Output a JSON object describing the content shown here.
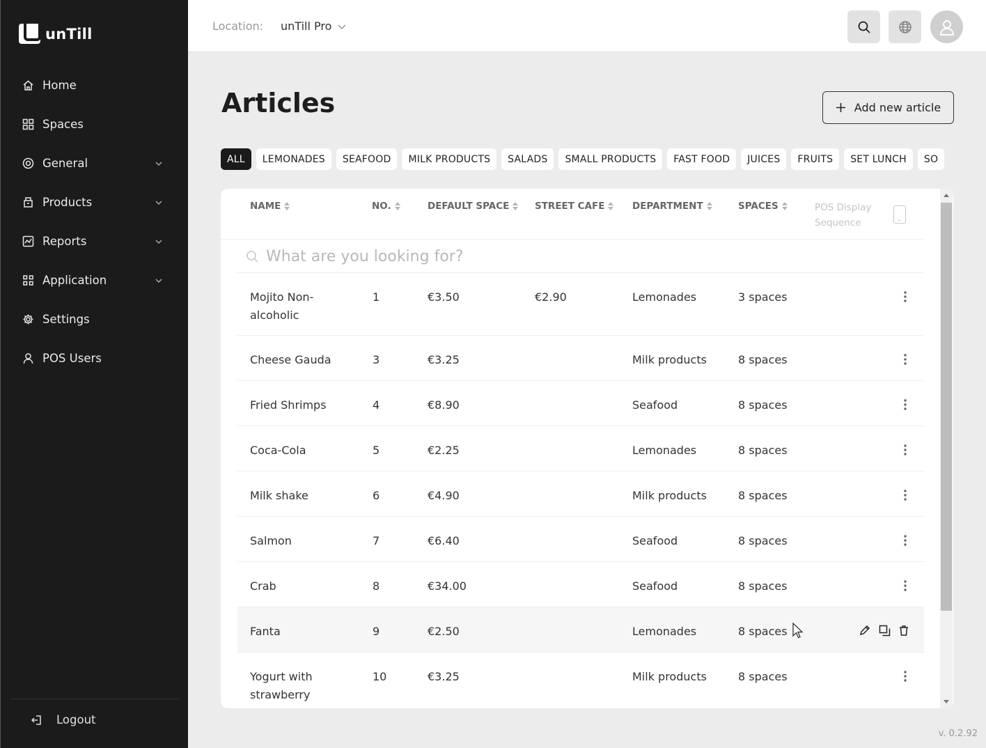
{
  "brand": {
    "name": "unTill"
  },
  "sidebar": {
    "items": [
      {
        "label": "Home",
        "icon": "home-icon",
        "expandable": false
      },
      {
        "label": "Spaces",
        "icon": "grid-icon",
        "expandable": false
      },
      {
        "label": "General",
        "icon": "target-icon",
        "expandable": true
      },
      {
        "label": "Products",
        "icon": "box-icon",
        "expandable": true
      },
      {
        "label": "Reports",
        "icon": "chart-icon",
        "expandable": true
      },
      {
        "label": "Application",
        "icon": "apps-icon",
        "expandable": true
      },
      {
        "label": "Settings",
        "icon": "gear-icon",
        "expandable": false
      },
      {
        "label": "POS Users",
        "icon": "user-icon",
        "expandable": false
      }
    ],
    "logout_label": "Logout"
  },
  "topbar": {
    "location_label": "Location:",
    "location_value": "unTill Pro"
  },
  "page": {
    "title": "Articles",
    "add_button_label": "Add new article"
  },
  "filters": [
    "ALL",
    "LEMONADES",
    "SEAFOOD",
    "MILK PRODUCTS",
    "SALADS",
    "SMALL PRODUCTS",
    "FAST FOOD",
    "JUICES",
    "FRUITS",
    "SET LUNCH",
    "SO"
  ],
  "active_filter": "ALL",
  "table": {
    "columns": {
      "name": "NAME",
      "no": "NO.",
      "default_space": "DEFAULT SPACE",
      "street_cafe": "STREET CAFE",
      "department": "DEPARTMENT",
      "spaces": "SPACES",
      "pos_display": "POS Display Sequence"
    },
    "search_placeholder": "What are you looking for?",
    "rows": [
      {
        "name": "Mojito Non-alcoholic",
        "no": "1",
        "default_space": "€3.50",
        "street_cafe": "€2.90",
        "department": "Lemonades",
        "spaces": "3 spaces"
      },
      {
        "name": "Cheese Gauda",
        "no": "3",
        "default_space": "€3.25",
        "street_cafe": "",
        "department": "Milk products",
        "spaces": "8 spaces"
      },
      {
        "name": "Fried Shrimps",
        "no": "4",
        "default_space": "€8.90",
        "street_cafe": "",
        "department": "Seafood",
        "spaces": "8 spaces"
      },
      {
        "name": "Coca-Cola",
        "no": "5",
        "default_space": "€2.25",
        "street_cafe": "",
        "department": "Lemonades",
        "spaces": "8 spaces"
      },
      {
        "name": "Milk shake",
        "no": "6",
        "default_space": "€4.90",
        "street_cafe": "",
        "department": "Milk products",
        "spaces": "8 spaces"
      },
      {
        "name": "Salmon",
        "no": "7",
        "default_space": "€6.40",
        "street_cafe": "",
        "department": "Seafood",
        "spaces": "8 spaces"
      },
      {
        "name": "Crab",
        "no": "8",
        "default_space": "€34.00",
        "street_cafe": "",
        "department": "Seafood",
        "spaces": "8 spaces"
      },
      {
        "name": "Fanta",
        "no": "9",
        "default_space": "€2.50",
        "street_cafe": "",
        "department": "Lemonades",
        "spaces": "8 spaces",
        "hovered": true
      },
      {
        "name": "Yogurt with strawberry",
        "no": "10",
        "default_space": "€3.25",
        "street_cafe": "",
        "department": "Milk products",
        "spaces": "8 spaces"
      }
    ]
  },
  "version": "v. 0.2.92"
}
